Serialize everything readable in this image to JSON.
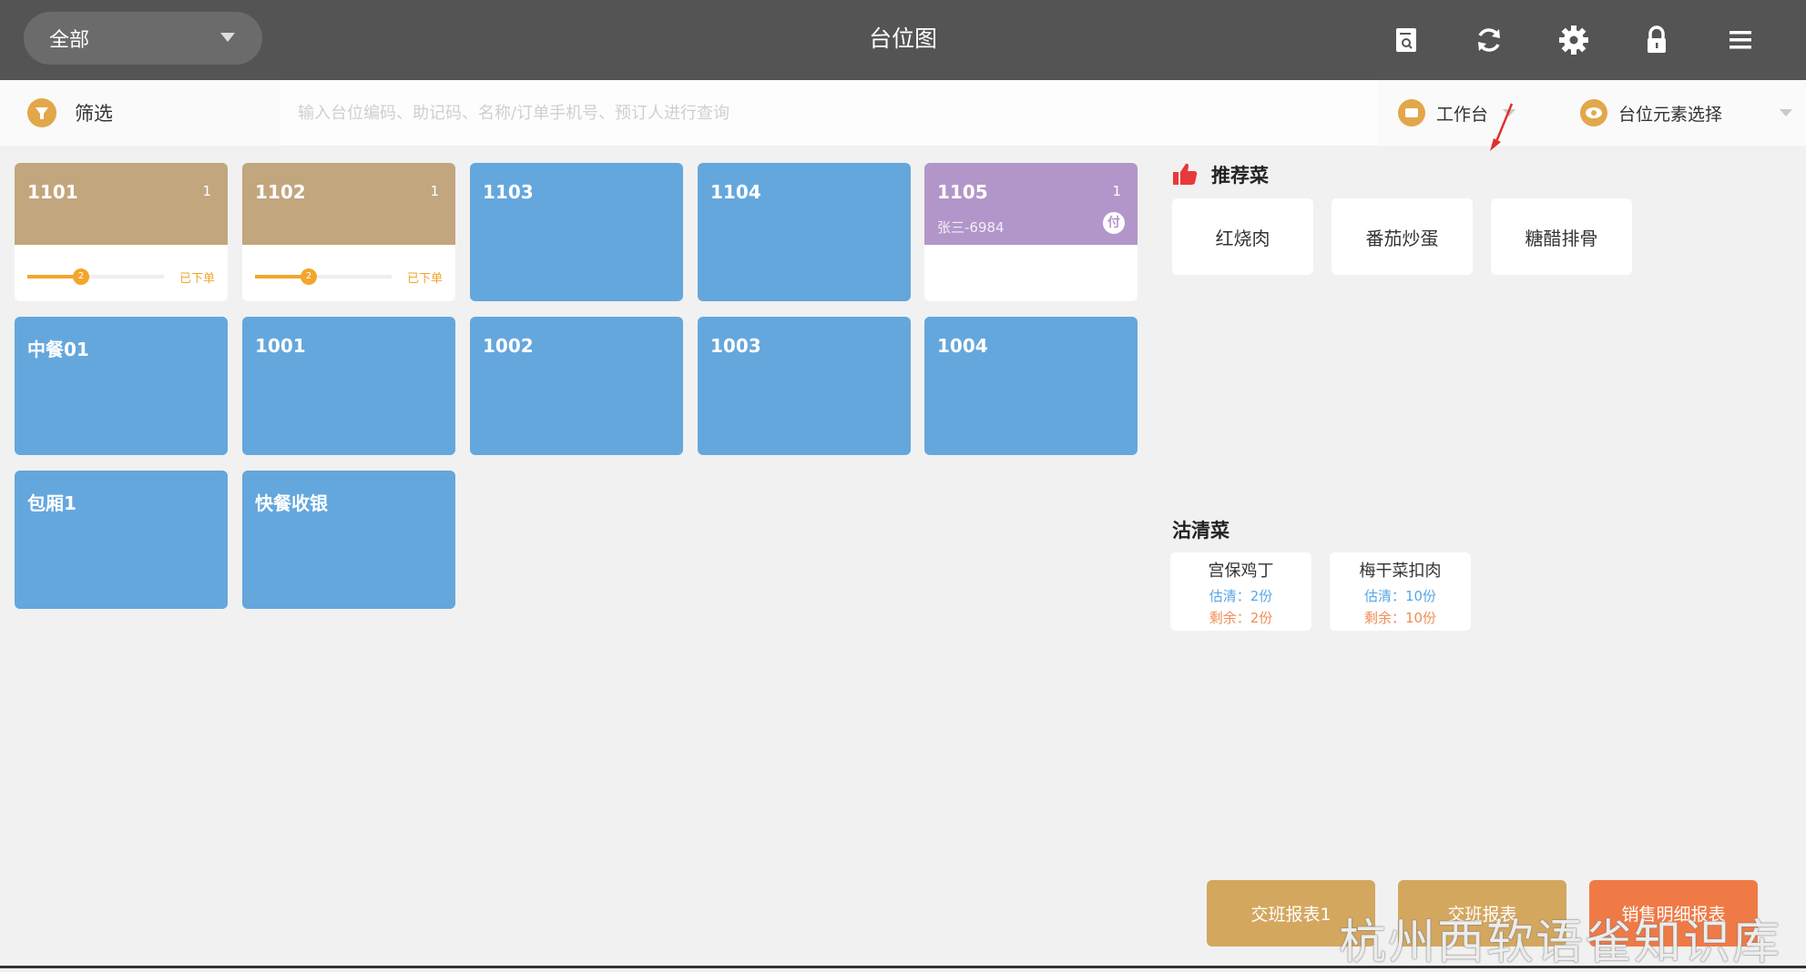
{
  "header": {
    "area_select": "全部",
    "title": "台位图",
    "icons": [
      "report-search-icon",
      "refresh-icon",
      "gear-icon",
      "lock-icon",
      "menu-icon"
    ]
  },
  "filterbar": {
    "filter_label": "筛选",
    "search_placeholder": "输入台位编码、助记码、名称/订单手机号、预订人进行查询",
    "workbench_label": "工作台",
    "element_select_label": "台位元素选择"
  },
  "tables": [
    {
      "name": "1101",
      "count": "1",
      "status": "occupied",
      "progress": 0.3,
      "progress_label": "2",
      "order_status": "已下单"
    },
    {
      "name": "1102",
      "count": "1",
      "status": "occupied",
      "progress": 0.3,
      "progress_label": "2",
      "order_status": "已下单"
    },
    {
      "name": "1103",
      "status": "free"
    },
    {
      "name": "1104",
      "status": "free"
    },
    {
      "name": "1105",
      "count": "1",
      "status": "reserved",
      "guest": "张三-6984",
      "badge": "付"
    },
    {
      "name": "中餐01",
      "status": "free"
    },
    {
      "name": "1001",
      "status": "free"
    },
    {
      "name": "1002",
      "status": "free"
    },
    {
      "name": "1003",
      "status": "free"
    },
    {
      "name": "1004",
      "status": "free"
    },
    {
      "name": "包厢1",
      "status": "free"
    },
    {
      "name": "快餐收银",
      "status": "free"
    }
  ],
  "recommended": {
    "title": "推荐菜",
    "dishes": [
      "红烧肉",
      "番茄炒蛋",
      "糖醋排骨"
    ]
  },
  "soldout": {
    "title": "沽清菜",
    "items": [
      {
        "name": "宫保鸡丁",
        "estimate": "估清：2份",
        "remaining": "剩余：2份"
      },
      {
        "name": "梅干菜扣肉",
        "estimate": "估清：10份",
        "remaining": "剩余：10份"
      }
    ]
  },
  "bottom_buttons": [
    "交班报表1",
    "交班报表",
    "销售明细报表"
  ],
  "watermark": "杭州西软语雀知识库",
  "colors": {
    "topbar": "#545454",
    "free_table": "#64a7dd",
    "occupied_table": "#c1a67e",
    "reserved_table": "#b296c9",
    "accent": "#e2a74a",
    "report_button": "#d4a75f",
    "sales_button": "#f07a45"
  }
}
